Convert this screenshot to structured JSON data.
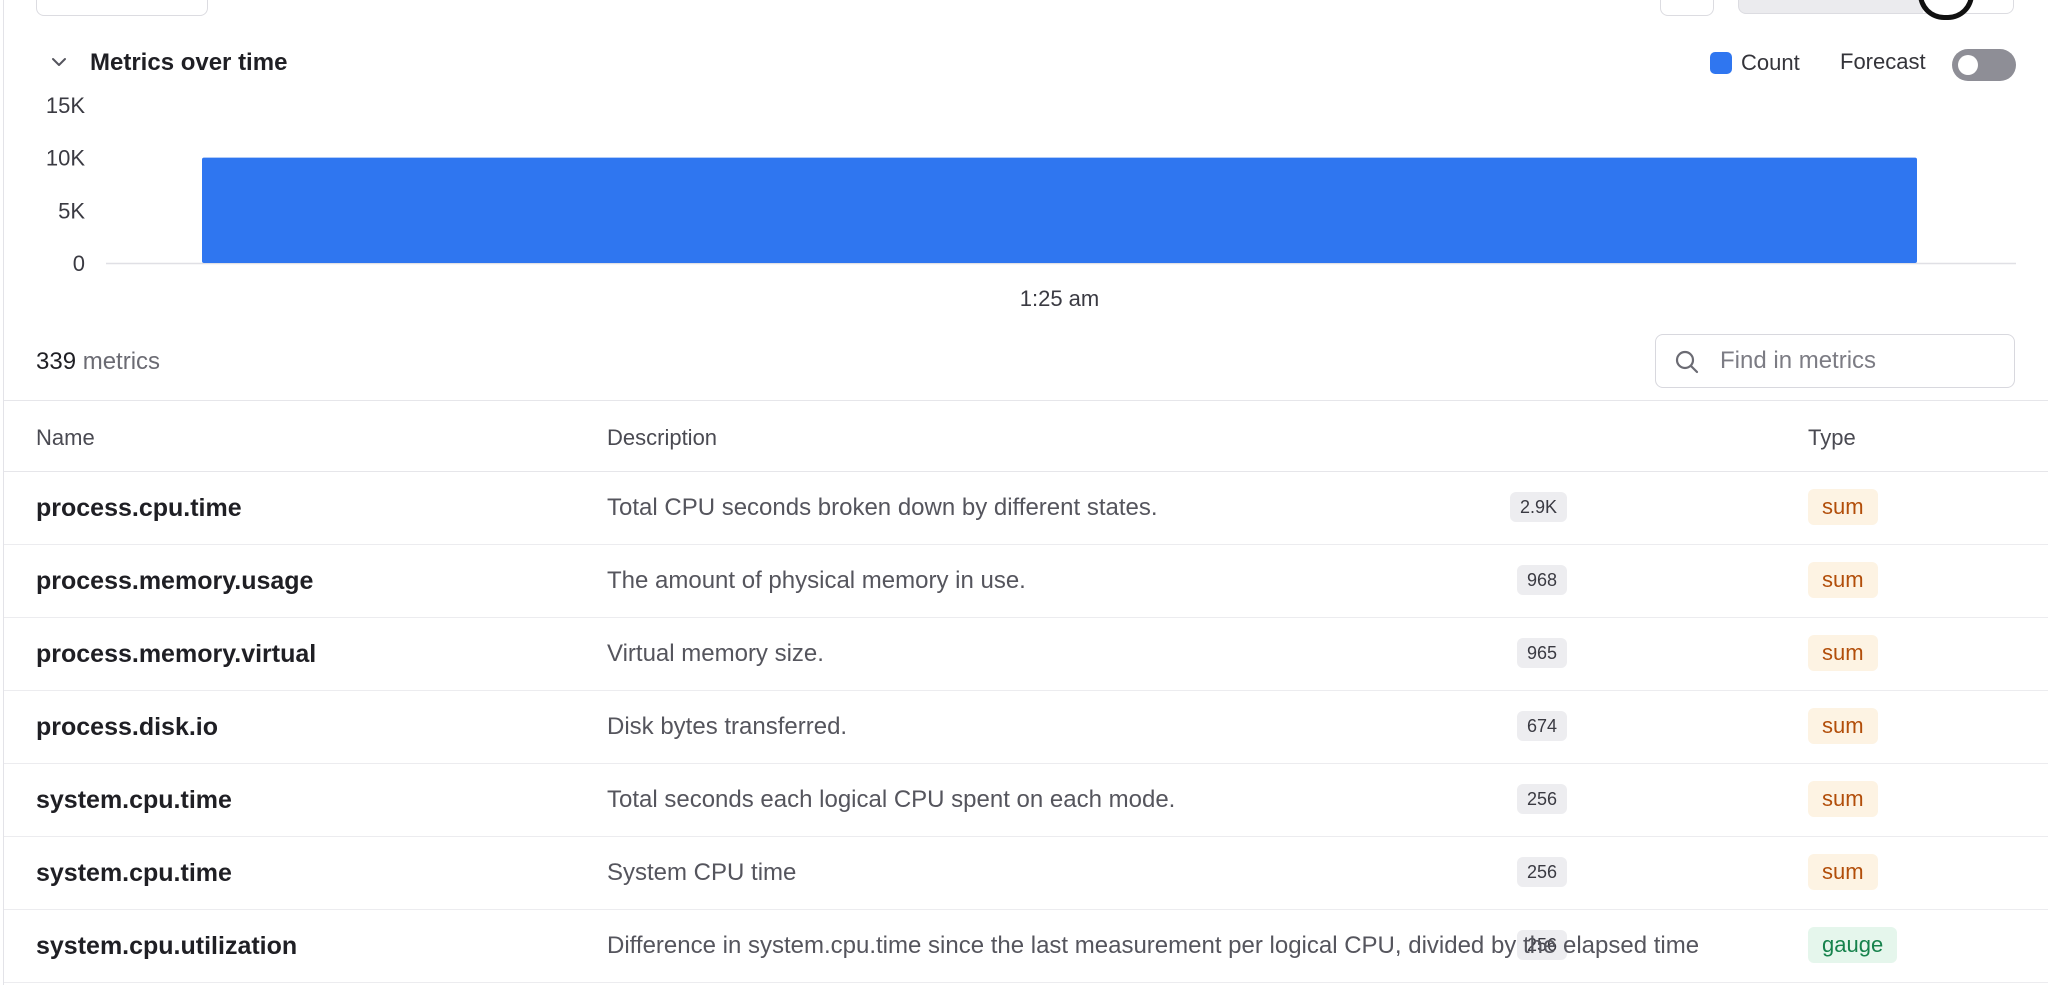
{
  "section": {
    "title": "Metrics over time",
    "legend_label": "Count",
    "forecast_label": "Forecast",
    "forecast_enabled": false,
    "colors": {
      "series": "#2f76f0",
      "toggle_off": "#8e8e96"
    }
  },
  "chart_data": {
    "type": "bar",
    "categories": [
      "1:25 am"
    ],
    "series": [
      {
        "name": "Count",
        "values": [
          10000
        ]
      }
    ],
    "ylim": [
      0,
      15000
    ],
    "yticks": [
      "0",
      "5K",
      "10K",
      "15K"
    ],
    "ytick_values": [
      0,
      5000,
      10000,
      15000
    ],
    "title": "",
    "xlabel": "",
    "ylabel": "",
    "grid": false,
    "legend": "top-right"
  },
  "metrics": {
    "count": "339",
    "count_label": "metrics",
    "search_placeholder": "Find in metrics",
    "search_value": ""
  },
  "table": {
    "headers": {
      "name": "Name",
      "description": "Description",
      "type": "Type"
    },
    "rows": [
      {
        "name": "process.cpu.time",
        "count": "2.9K",
        "description": "Total CPU seconds broken down by different states.",
        "type": "sum"
      },
      {
        "name": "process.memory.usage",
        "count": "968",
        "description": "The amount of physical memory in use.",
        "type": "sum"
      },
      {
        "name": "process.memory.virtual",
        "count": "965",
        "description": "Virtual memory size.",
        "type": "sum"
      },
      {
        "name": "process.disk.io",
        "count": "674",
        "description": "Disk bytes transferred.",
        "type": "sum"
      },
      {
        "name": "system.cpu.time",
        "count": "256",
        "description": "Total seconds each logical CPU spent on each mode.",
        "type": "sum"
      },
      {
        "name": "system.cpu.time",
        "count": "256",
        "description": "System CPU time",
        "type": "sum"
      },
      {
        "name": "system.cpu.utilization",
        "count": "256",
        "description": "Difference in system.cpu.time since the last measurement per logical CPU, divided by the elapsed time",
        "type": "gauge"
      }
    ]
  }
}
